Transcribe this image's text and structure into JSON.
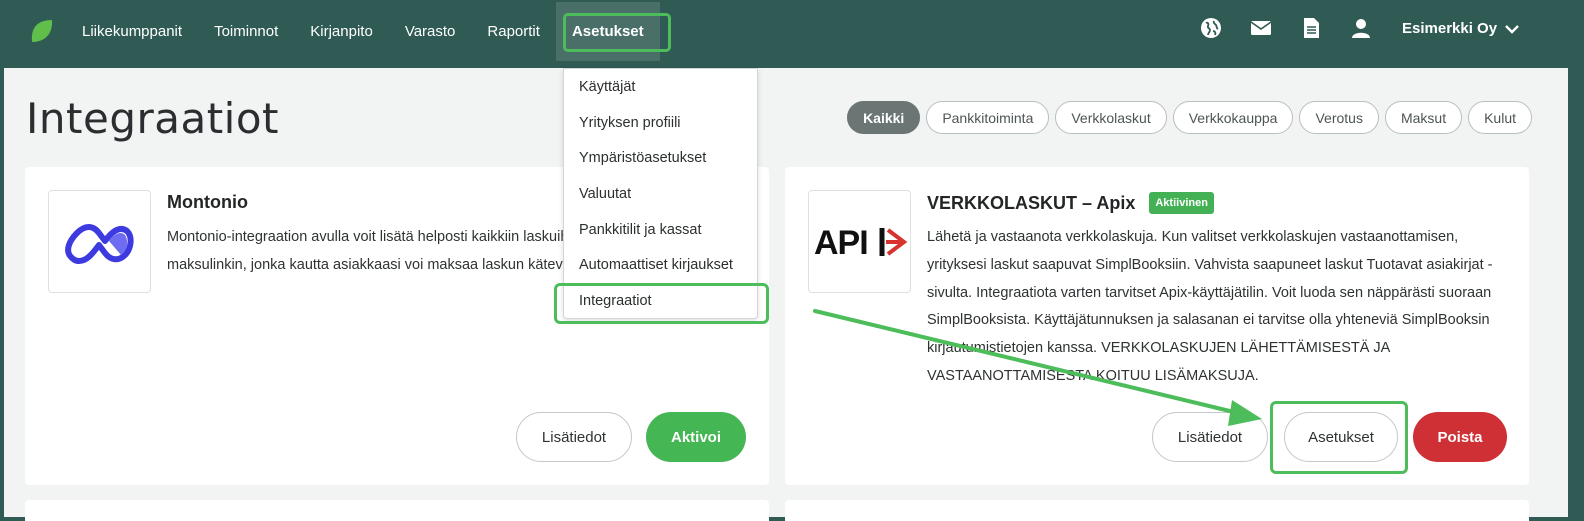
{
  "nav": {
    "items": [
      {
        "label": "Liikekumppanit"
      },
      {
        "label": "Toiminnot"
      },
      {
        "label": "Kirjanpito"
      },
      {
        "label": "Varasto"
      },
      {
        "label": "Raportit"
      },
      {
        "label": "Asetukset",
        "active": true
      }
    ],
    "company": "Esimerkki Oy",
    "icons": [
      "globe-icon",
      "mail-icon",
      "document-icon",
      "user-icon",
      "chevron-down-icon"
    ]
  },
  "page": {
    "title": "Integraatiot"
  },
  "filters": [
    {
      "label": "Kaikki",
      "active": true
    },
    {
      "label": "Pankkitoiminta"
    },
    {
      "label": "Verkkolaskut"
    },
    {
      "label": "Verkkokauppa"
    },
    {
      "label": "Verotus"
    },
    {
      "label": "Maksut"
    },
    {
      "label": "Kulut"
    }
  ],
  "dropdown": {
    "items": [
      {
        "label": "Käyttäjät"
      },
      {
        "label": "Yrityksen profiili"
      },
      {
        "label": "Ympäristöasetukset"
      },
      {
        "label": "Valuutat"
      },
      {
        "label": "Pankkitilit ja kassat"
      },
      {
        "label": "Automaattiset kirjaukset"
      },
      {
        "label": "Integraatiot"
      }
    ]
  },
  "cards": [
    {
      "title": "Montonio",
      "description": "Montonio-integraation avulla voit lisätä helposti kaikkiin laskuihisi automaattisen maksulinkin, jonka kautta asiakkaasi voi maksaa laskun kätevästi verkkopankissa.",
      "info_label": "Lisätiedot",
      "action_label": "Aktivoi"
    },
    {
      "title": "VERKKOLASKUT – Apix",
      "badge": "Aktiivinen",
      "logo_text": "API",
      "description": "Lähetä ja vastaanota verkkolaskuja. Kun valitset verkkolaskujen vastaanottamisen, yrityksesi laskut saapuvat SimplBooksiin. Vahvista saapuneet laskut Tuotavat asiakirjat -sivulta. Integraatiota varten tarvitset Apix-käyttäjätilin. Voit luoda sen näppärästi suoraan SimplBooksista. Käyttäjätunnuksen ja salasanan ei tarvitse olla yhteneviä SimplBooksin kirjautumistietojen kanssa. VERKKOLASKUJEN LÄHETTÄMISESTÄ JA VASTAANOTTAMISESTA KOITUU LISÄMAKSUJA.",
      "info_label": "Lisätiedot",
      "settings_label": "Asetukset",
      "remove_label": "Poista"
    }
  ],
  "colors": {
    "nav_bg": "#2f5b54",
    "accent_green": "#44b654",
    "danger_red": "#cf3035",
    "highlight": "#4cbd5a"
  }
}
